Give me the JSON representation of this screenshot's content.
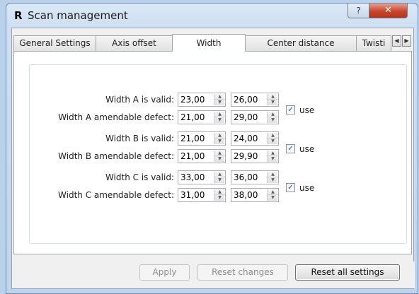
{
  "window": {
    "logo": "R",
    "title": "Scan management",
    "help_label": "?",
    "close_label": "✕"
  },
  "tabs": [
    {
      "label": "General Settings",
      "active": false
    },
    {
      "label": "Axis offset",
      "active": false
    },
    {
      "label": "Width",
      "active": true
    },
    {
      "label": "Center distance",
      "active": false
    },
    {
      "label": "Twisti",
      "active": false
    }
  ],
  "tab_scroll": {
    "left": "◀",
    "right": "▶"
  },
  "width_settings": [
    {
      "valid_label": "Width A is valid:",
      "valid_min": "23,00",
      "valid_max": "26,00",
      "defect_label": "Width A amendable defect:",
      "defect_min": "21,00",
      "defect_max": "29,00",
      "use_checked": true,
      "use_label": "use"
    },
    {
      "valid_label": "Width B is valid:",
      "valid_min": "21,00",
      "valid_max": "24,00",
      "defect_label": "Width B amendable defect:",
      "defect_min": "21,00",
      "defect_max": "29,90",
      "use_checked": true,
      "use_label": "use"
    },
    {
      "valid_label": "Width C is valid:",
      "valid_min": "33,00",
      "valid_max": "36,00",
      "defect_label": "Width C amendable defect:",
      "defect_min": "31,00",
      "defect_max": "38,00",
      "use_checked": true,
      "use_label": "use"
    }
  ],
  "spin_glyphs": {
    "up": "▲",
    "down": "▼",
    "check": "✓"
  },
  "buttons": {
    "apply": "Apply",
    "reset_changes": "Reset changes",
    "reset_all": "Reset all settings"
  },
  "colors": {
    "title_bar": "#cfe0f2",
    "close_button": "#c9462c",
    "panel_bg": "#ffffff",
    "dialog_bg": "#f0f0f0"
  }
}
